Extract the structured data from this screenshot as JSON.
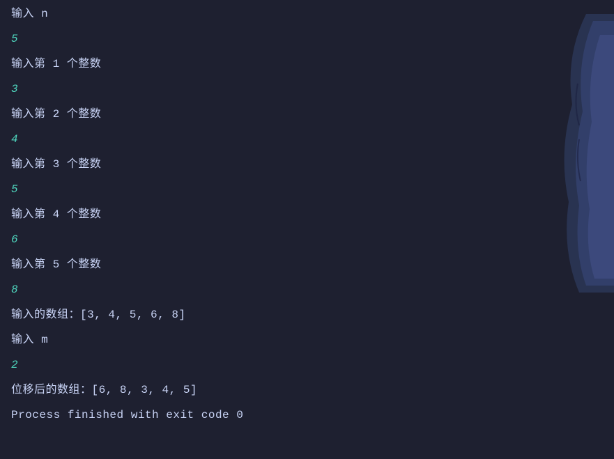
{
  "console": {
    "lines": [
      {
        "type": "prompt",
        "text": "输入 n"
      },
      {
        "type": "input",
        "text": "5"
      },
      {
        "type": "prompt",
        "text": "输入第 1 个整数"
      },
      {
        "type": "input",
        "text": "3"
      },
      {
        "type": "prompt",
        "text": "输入第 2 个整数"
      },
      {
        "type": "input",
        "text": "4"
      },
      {
        "type": "prompt",
        "text": "输入第 3 个整数"
      },
      {
        "type": "input",
        "text": "5"
      },
      {
        "type": "prompt",
        "text": "输入第 4 个整数"
      },
      {
        "type": "input",
        "text": "6"
      },
      {
        "type": "prompt",
        "text": "输入第 5 个整数"
      },
      {
        "type": "input",
        "text": "8"
      },
      {
        "type": "prompt",
        "text": "输入的数组：[3, 4, 5, 6, 8]"
      },
      {
        "type": "prompt",
        "text": "输入 m"
      },
      {
        "type": "input",
        "text": "2"
      },
      {
        "type": "prompt",
        "text": "位移后的数组：[6, 8, 3, 4, 5]"
      },
      {
        "type": "blank",
        "text": ""
      },
      {
        "type": "prompt",
        "text": "Process finished with exit code 0"
      }
    ]
  },
  "colors": {
    "background": "#1e2030",
    "prompt_text": "#c8d3f5",
    "input_text": "#4fd6be",
    "decoration_dark": "#2a3050",
    "decoration_light": "#3a4470"
  }
}
